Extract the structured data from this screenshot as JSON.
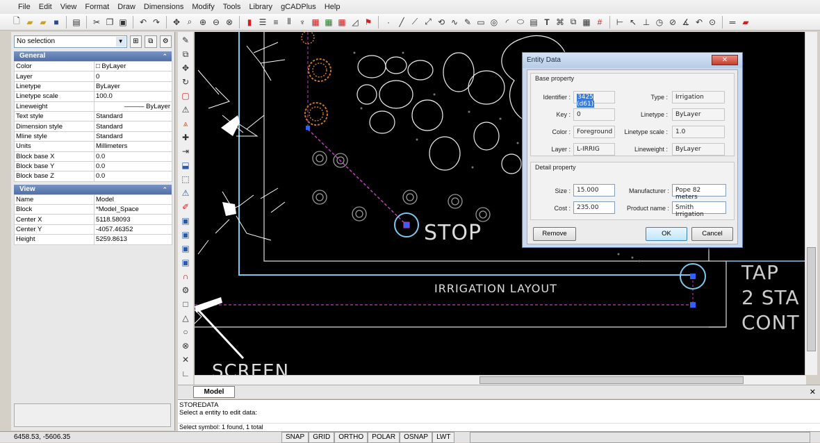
{
  "menu": [
    "File",
    "Edit",
    "View",
    "Format",
    "Draw",
    "Dimensions",
    "Modify",
    "Tools",
    "Library",
    "gCADPlus",
    "Help"
  ],
  "selection": {
    "value": "No selection"
  },
  "general": {
    "title": "General",
    "rows": [
      {
        "k": "Color",
        "v": "□ ByLayer"
      },
      {
        "k": "Layer",
        "v": "0"
      },
      {
        "k": "Linetype",
        "v": "ByLayer"
      },
      {
        "k": "Linetype scale",
        "v": "100.0"
      },
      {
        "k": "Lineweight",
        "v": "——— ByLayer"
      },
      {
        "k": "Text style",
        "v": "Standard"
      },
      {
        "k": "Dimension style",
        "v": "Standard"
      },
      {
        "k": "Mline style",
        "v": "Standard"
      },
      {
        "k": "Units",
        "v": "Millimeters"
      },
      {
        "k": "Block base X",
        "v": "0.0"
      },
      {
        "k": "Block base Y",
        "v": "0.0"
      },
      {
        "k": "Block base Z",
        "v": "0.0"
      }
    ]
  },
  "view": {
    "title": "View",
    "rows": [
      {
        "k": "Name",
        "v": "Model"
      },
      {
        "k": "Block",
        "v": "*Model_Space"
      },
      {
        "k": "Center X",
        "v": "5118.58093"
      },
      {
        "k": "Center Y",
        "v": "-4057.46352"
      },
      {
        "k": "Height",
        "v": "5259.8613"
      }
    ]
  },
  "canvas_text": {
    "stop": "STOP",
    "irrigation_layout": "IRRIGATION LAYOUT",
    "tap": "TAP",
    "two_sta": "2 STA",
    "cont": "CONT",
    "screen": "SCREEN"
  },
  "dialog": {
    "title": "Entity Data",
    "base_title": "Base property",
    "identifier_label": "Identifier :",
    "identifier_value": "3425 (d61)",
    "type_label": "Type :",
    "type_value": "Irrigation",
    "key_label": "Key :",
    "key_value": "0",
    "linetype_label": "Linetype :",
    "linetype_value": "ByLayer",
    "color_label": "Color :",
    "color_value": "Foreground",
    "linetype_scale_label": "Linetype scale :",
    "linetype_scale_value": "1.0",
    "layer_label": "Layer :",
    "layer_value": "L-IRRIG",
    "lineweight_label": "Lineweight :",
    "lineweight_value": "ByLayer",
    "detail_title": "Detail property",
    "size_label": "Size :",
    "size_value": "15.000",
    "manufacturer_label": "Manufacturer :",
    "manufacturer_value": "Pope 82 meters",
    "cost_label": "Cost :",
    "cost_value": "235.00",
    "product_label": "Product name :",
    "product_value": "Smith Irrigation",
    "remove_label": "Remove",
    "ok_label": "OK",
    "cancel_label": "Cancel"
  },
  "tabs": {
    "model": "Model"
  },
  "command": {
    "line1": "STOREDATA",
    "line2": "Select a entity to edit data:",
    "line3": "Select symbol: 1 found, 1 total"
  },
  "status": {
    "coords": "6458.53, -5606.35",
    "buttons": [
      "SNAP",
      "GRID",
      "ORTHO",
      "POLAR",
      "OSNAP",
      "LWT"
    ]
  },
  "colors": {
    "canvas": "#000000",
    "accent": "#4f6fa8",
    "cyan": "#7ec8f0",
    "magenta": "#c040c0",
    "orange": "#c87828"
  }
}
